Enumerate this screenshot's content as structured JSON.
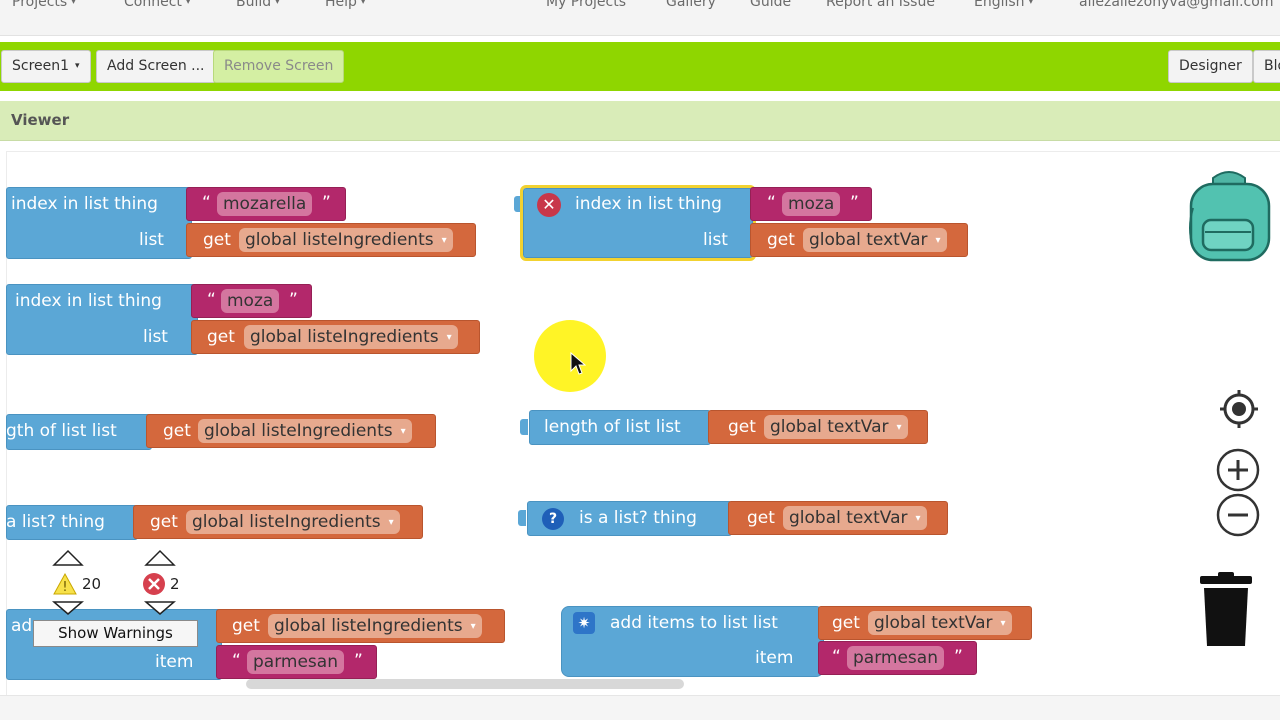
{
  "nav": {
    "left": [
      "Projects",
      "Connect",
      "Build",
      "Help"
    ],
    "right": [
      "My Projects",
      "Gallery",
      "Guide",
      "Report an Issue",
      "English",
      "allezallezonyva@gmail.com"
    ]
  },
  "toolbar": {
    "screen": "Screen1",
    "add_screen": "Add Screen ...",
    "remove_screen": "Remove Screen",
    "designer": "Designer",
    "blocks": "Blo"
  },
  "viewer": {
    "title": "Viewer"
  },
  "blocks": {
    "b1": {
      "label1": "index in list  thing",
      "label2": "list",
      "text": "mozarella",
      "get": "get",
      "var": "global listeIngredients"
    },
    "b2": {
      "label1": "index in list  thing",
      "label2": "list",
      "text": "moza",
      "get": "get",
      "var": "global textVar"
    },
    "b3": {
      "label1": "index in list  thing",
      "label2": "list",
      "text": "moza",
      "get": "get",
      "var": "global listeIngredients"
    },
    "b4": {
      "label1": "gth of list  list",
      "get": "get",
      "var": "global listeIngredients"
    },
    "b5": {
      "label1": "length of list  list",
      "get": "get",
      "var": "global textVar"
    },
    "b6": {
      "label1": "a list?  thing",
      "get": "get",
      "var": "global listeIngredients"
    },
    "b7": {
      "label1": "is a list?  thing",
      "get": "get",
      "var": "global textVar"
    },
    "b8": {
      "label1": "ad",
      "label2": "item",
      "get": "get",
      "var": "global listeIngredients",
      "text": "parmesan"
    },
    "b9": {
      "label1": "add items to list  list",
      "label2": "item",
      "get": "get",
      "var": "global textVar",
      "text": "parmesan"
    }
  },
  "warnings": {
    "warn_count": "20",
    "error_count": "2",
    "show_label": "Show Warnings"
  },
  "quote_open": "“",
  "quote_close": "”",
  "dropdown_glyph": "▾",
  "caret_glyph": "▾",
  "icons": {
    "backpack": "backpack-icon",
    "target": "target-icon",
    "zoom_in": "zoom-in-icon",
    "zoom_out": "zoom-out-icon",
    "trash": "trash-icon"
  }
}
